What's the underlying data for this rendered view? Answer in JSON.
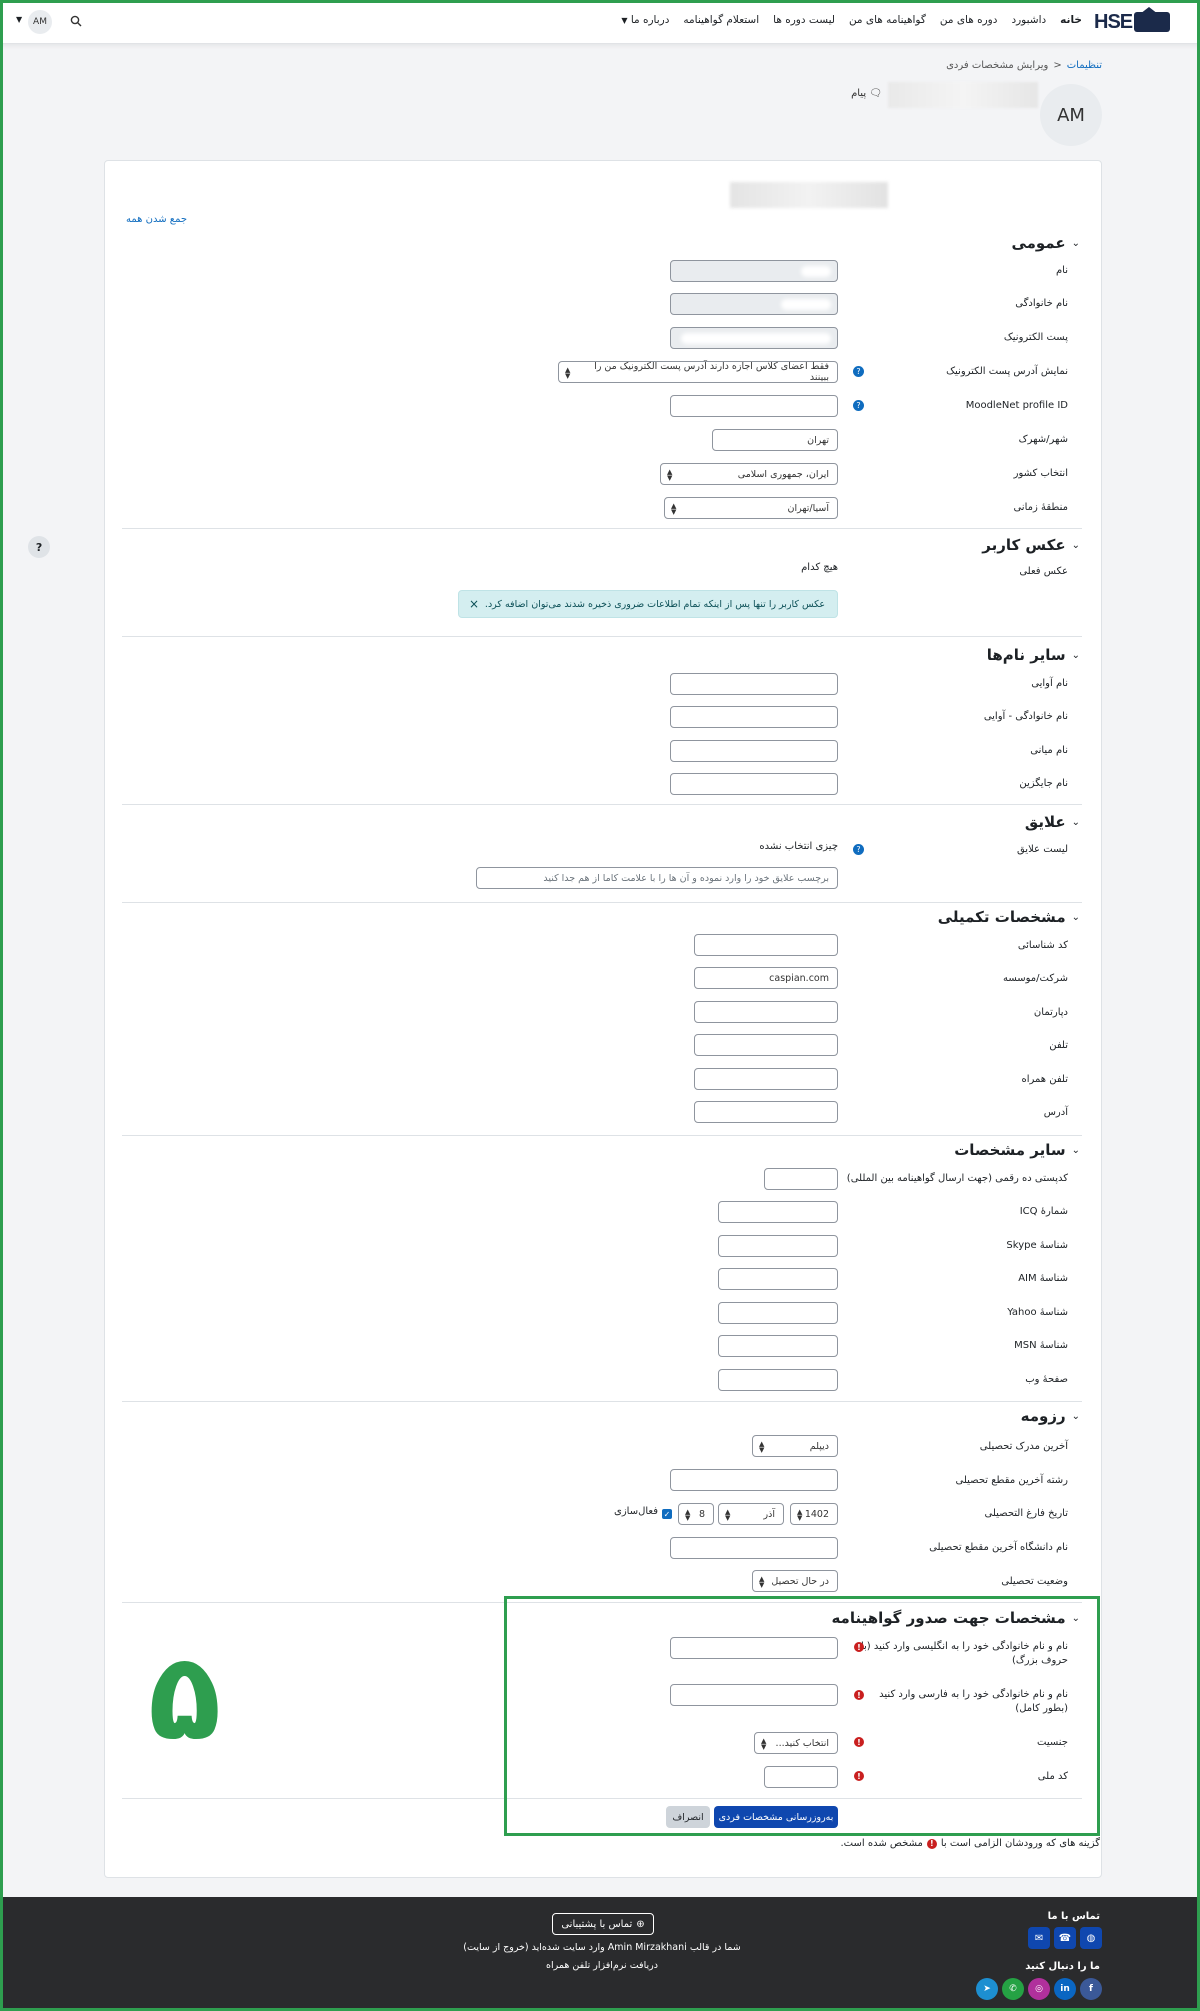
{
  "nav": {
    "logo_text": "HSE",
    "items": [
      "خانه",
      "داشبورد",
      "دوره های من",
      "گواهینامه های من",
      "لیست دوره ها",
      "استعلام گواهینامه",
      "درباره ما"
    ],
    "user_initials": "AM"
  },
  "breadcrumb": {
    "first": "تنظیمات",
    "sep": "<",
    "current": "ویرایش مشخصات فردی"
  },
  "header": {
    "initials": "AM",
    "message": "پیام"
  },
  "collapse_all": "جمع شدن همه",
  "general": {
    "title": "عمومی",
    "first_name": "نام",
    "last_name": "نام خانوادگی",
    "email": "پست الکترونیک",
    "email_display": "نمایش آدرس پست الکترونیک",
    "email_display_value": "فقط اعضای کلاس اجازه دارند آدرس پست الکترونیک من را ببینند",
    "moodlenet": "MoodleNet profile ID",
    "city": "شهر/شهرک",
    "city_value": "تهران",
    "country": "انتخاب کشور",
    "country_value": "ایران، جمهوری اسلامی",
    "timezone": "منطقهٔ زمانی",
    "timezone_value": "آسیا/تهران"
  },
  "picture": {
    "title": "عکس کاربر",
    "current": "عکس فعلی",
    "none": "هیچ کدام",
    "alert": "عکس کاربر را تنها پس از اینکه تمام اطلاعات ضروری ذخیره شدند می‌توان اضافه کرد."
  },
  "other_names": {
    "title": "سایر نام‌ها",
    "f1": "نام آوایی",
    "f2": "نام خانوادگی - آوایی",
    "f3": "نام میانی",
    "f4": "نام جایگزین"
  },
  "interests": {
    "title": "علایق",
    "label": "لیست علایق",
    "none": "چیزی انتخاب نشده",
    "placeholder": "برچسب علایق خود را وارد نموده و آن ها را با علامت کاما از هم جدا کنید"
  },
  "optional": {
    "title": "مشخصات تکمیلی",
    "id": "کد شناسائی",
    "company": "شرکت/موسسه",
    "company_value": "caspian.com",
    "dept": "دپارتمان",
    "phone": "تلفن",
    "mobile": "تلفن همراه",
    "address": "آدرس"
  },
  "other_info": {
    "title": "سایر مشخصات",
    "postal": "کدپستی ده رقمی (جهت ارسال گواهینامه بین المللی)",
    "icq": "شمارهٔ ICQ",
    "skype": "شناسهٔ Skype",
    "aim": "شناسهٔ AIM",
    "yahoo": "شناسهٔ Yahoo",
    "msn": "شناسهٔ MSN",
    "web": "صفحهٔ وب"
  },
  "resume": {
    "title": "رزومه",
    "degree": "آخرین مدرک تحصیلی",
    "degree_value": "دیپلم",
    "field": "رشته آخرین مقطع تحصیلی",
    "grad_date": "تاریخ فارغ التحصیلی",
    "year": "1402",
    "month": "آذر",
    "day": "8",
    "enable": "فعال‌سازی",
    "university": "نام دانشگاه آخرین مقطع تحصیلی",
    "status": "وضعیت تحصیلی",
    "status_value": "در حال تحصیل"
  },
  "certificate": {
    "title": "مشخصات جهت صدور گواهینامه",
    "en_name": "نام و نام خانوادگی خود را به انگلیسی وارد کنید (با حروف بزرگ)",
    "fa_name": "نام و نام خانوادگی خود را به فارسی وارد کنید (بطور کامل)",
    "gender": "جنسیت",
    "gender_value": "انتخاب کنید...",
    "national_id": "کد ملی"
  },
  "buttons": {
    "submit": "به‌روزرسانی مشخصات فردی",
    "cancel": "انصراف"
  },
  "required_note": {
    "before": "گزینه های که ورودشان الزامی است با",
    "after": "مشخص شده است."
  },
  "annotation_number": "۵",
  "footer": {
    "contact_title": "تماس با ما",
    "follow_title": "ما را دنبال کنید",
    "support": "تماس با پشتیبانی",
    "logged_in": "شما در قالب Amin Mirzakhani وارد سایت شده‌اید (خروج از سایت)",
    "mobile_app": "دریافت نرم‌افزار تلفن همراه"
  },
  "colors": {
    "accent": "#0f6cbf",
    "primary_button": "#0f47af",
    "highlight": "#2e9e4f",
    "footer": "#2a2b2d"
  }
}
